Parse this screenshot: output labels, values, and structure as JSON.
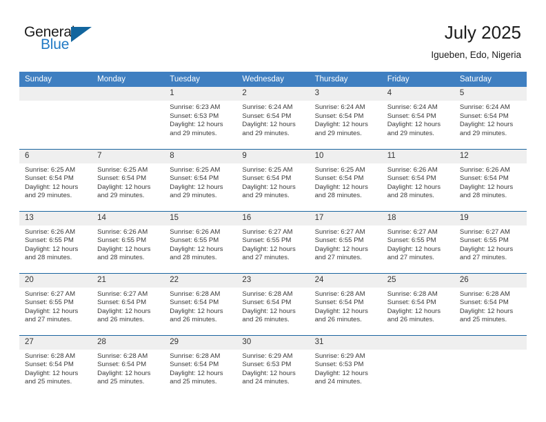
{
  "brand": {
    "name_top": "General",
    "name_bottom": "Blue",
    "logo_icon": "triangle-flag-icon",
    "color_dark": "#1b1b1b",
    "color_blue": "#2079c4",
    "color_triangle": "#12659e"
  },
  "header": {
    "title": "July 2025",
    "subtitle": "Igueben, Edo, Nigeria"
  },
  "theme": {
    "header_row_bg": "#3f7fc1",
    "daynum_bg": "#efefef",
    "row_border": "#17639e",
    "text": "#3a3a3a"
  },
  "weekday_headers": [
    "Sunday",
    "Monday",
    "Tuesday",
    "Wednesday",
    "Thursday",
    "Friday",
    "Saturday"
  ],
  "labels": {
    "sunrise_prefix": "Sunrise:",
    "sunset_prefix": "Sunset:",
    "daylight_prefix": "Daylight:"
  },
  "weeks": [
    [
      {
        "day": "",
        "blank": true
      },
      {
        "day": "",
        "blank": true
      },
      {
        "day": "1",
        "sunrise": "Sunrise: 6:23 AM",
        "sunset": "Sunset: 6:53 PM",
        "daylight": "Daylight: 12 hours and 29 minutes."
      },
      {
        "day": "2",
        "sunrise": "Sunrise: 6:24 AM",
        "sunset": "Sunset: 6:54 PM",
        "daylight": "Daylight: 12 hours and 29 minutes."
      },
      {
        "day": "3",
        "sunrise": "Sunrise: 6:24 AM",
        "sunset": "Sunset: 6:54 PM",
        "daylight": "Daylight: 12 hours and 29 minutes."
      },
      {
        "day": "4",
        "sunrise": "Sunrise: 6:24 AM",
        "sunset": "Sunset: 6:54 PM",
        "daylight": "Daylight: 12 hours and 29 minutes."
      },
      {
        "day": "5",
        "sunrise": "Sunrise: 6:24 AM",
        "sunset": "Sunset: 6:54 PM",
        "daylight": "Daylight: 12 hours and 29 minutes."
      }
    ],
    [
      {
        "day": "6",
        "sunrise": "Sunrise: 6:25 AM",
        "sunset": "Sunset: 6:54 PM",
        "daylight": "Daylight: 12 hours and 29 minutes."
      },
      {
        "day": "7",
        "sunrise": "Sunrise: 6:25 AM",
        "sunset": "Sunset: 6:54 PM",
        "daylight": "Daylight: 12 hours and 29 minutes."
      },
      {
        "day": "8",
        "sunrise": "Sunrise: 6:25 AM",
        "sunset": "Sunset: 6:54 PM",
        "daylight": "Daylight: 12 hours and 29 minutes."
      },
      {
        "day": "9",
        "sunrise": "Sunrise: 6:25 AM",
        "sunset": "Sunset: 6:54 PM",
        "daylight": "Daylight: 12 hours and 29 minutes."
      },
      {
        "day": "10",
        "sunrise": "Sunrise: 6:25 AM",
        "sunset": "Sunset: 6:54 PM",
        "daylight": "Daylight: 12 hours and 28 minutes."
      },
      {
        "day": "11",
        "sunrise": "Sunrise: 6:26 AM",
        "sunset": "Sunset: 6:54 PM",
        "daylight": "Daylight: 12 hours and 28 minutes."
      },
      {
        "day": "12",
        "sunrise": "Sunrise: 6:26 AM",
        "sunset": "Sunset: 6:54 PM",
        "daylight": "Daylight: 12 hours and 28 minutes."
      }
    ],
    [
      {
        "day": "13",
        "sunrise": "Sunrise: 6:26 AM",
        "sunset": "Sunset: 6:55 PM",
        "daylight": "Daylight: 12 hours and 28 minutes."
      },
      {
        "day": "14",
        "sunrise": "Sunrise: 6:26 AM",
        "sunset": "Sunset: 6:55 PM",
        "daylight": "Daylight: 12 hours and 28 minutes."
      },
      {
        "day": "15",
        "sunrise": "Sunrise: 6:26 AM",
        "sunset": "Sunset: 6:55 PM",
        "daylight": "Daylight: 12 hours and 28 minutes."
      },
      {
        "day": "16",
        "sunrise": "Sunrise: 6:27 AM",
        "sunset": "Sunset: 6:55 PM",
        "daylight": "Daylight: 12 hours and 27 minutes."
      },
      {
        "day": "17",
        "sunrise": "Sunrise: 6:27 AM",
        "sunset": "Sunset: 6:55 PM",
        "daylight": "Daylight: 12 hours and 27 minutes."
      },
      {
        "day": "18",
        "sunrise": "Sunrise: 6:27 AM",
        "sunset": "Sunset: 6:55 PM",
        "daylight": "Daylight: 12 hours and 27 minutes."
      },
      {
        "day": "19",
        "sunrise": "Sunrise: 6:27 AM",
        "sunset": "Sunset: 6:55 PM",
        "daylight": "Daylight: 12 hours and 27 minutes."
      }
    ],
    [
      {
        "day": "20",
        "sunrise": "Sunrise: 6:27 AM",
        "sunset": "Sunset: 6:55 PM",
        "daylight": "Daylight: 12 hours and 27 minutes."
      },
      {
        "day": "21",
        "sunrise": "Sunrise: 6:27 AM",
        "sunset": "Sunset: 6:54 PM",
        "daylight": "Daylight: 12 hours and 26 minutes."
      },
      {
        "day": "22",
        "sunrise": "Sunrise: 6:28 AM",
        "sunset": "Sunset: 6:54 PM",
        "daylight": "Daylight: 12 hours and 26 minutes."
      },
      {
        "day": "23",
        "sunrise": "Sunrise: 6:28 AM",
        "sunset": "Sunset: 6:54 PM",
        "daylight": "Daylight: 12 hours and 26 minutes."
      },
      {
        "day": "24",
        "sunrise": "Sunrise: 6:28 AM",
        "sunset": "Sunset: 6:54 PM",
        "daylight": "Daylight: 12 hours and 26 minutes."
      },
      {
        "day": "25",
        "sunrise": "Sunrise: 6:28 AM",
        "sunset": "Sunset: 6:54 PM",
        "daylight": "Daylight: 12 hours and 26 minutes."
      },
      {
        "day": "26",
        "sunrise": "Sunrise: 6:28 AM",
        "sunset": "Sunset: 6:54 PM",
        "daylight": "Daylight: 12 hours and 25 minutes."
      }
    ],
    [
      {
        "day": "27",
        "sunrise": "Sunrise: 6:28 AM",
        "sunset": "Sunset: 6:54 PM",
        "daylight": "Daylight: 12 hours and 25 minutes."
      },
      {
        "day": "28",
        "sunrise": "Sunrise: 6:28 AM",
        "sunset": "Sunset: 6:54 PM",
        "daylight": "Daylight: 12 hours and 25 minutes."
      },
      {
        "day": "29",
        "sunrise": "Sunrise: 6:28 AM",
        "sunset": "Sunset: 6:54 PM",
        "daylight": "Daylight: 12 hours and 25 minutes."
      },
      {
        "day": "30",
        "sunrise": "Sunrise: 6:29 AM",
        "sunset": "Sunset: 6:53 PM",
        "daylight": "Daylight: 12 hours and 24 minutes."
      },
      {
        "day": "31",
        "sunrise": "Sunrise: 6:29 AM",
        "sunset": "Sunset: 6:53 PM",
        "daylight": "Daylight: 12 hours and 24 minutes."
      },
      {
        "day": "",
        "blank": true
      },
      {
        "day": "",
        "blank": true
      }
    ]
  ]
}
